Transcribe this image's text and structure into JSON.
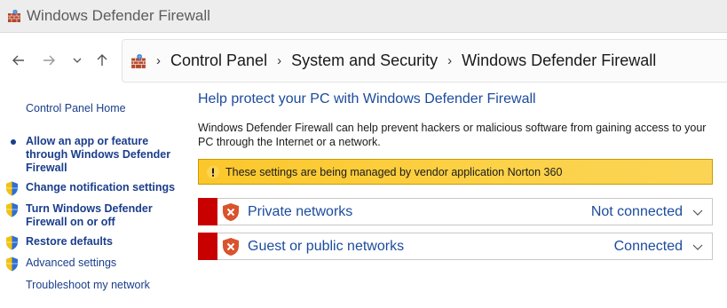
{
  "window": {
    "title": "Windows Defender Firewall",
    "icon": "firewall-icon"
  },
  "nav": {
    "back_icon": "arrow-left-icon",
    "forward_icon": "arrow-right-icon",
    "recent_icon": "chevron-down-icon",
    "up_icon": "arrow-up-icon"
  },
  "address": {
    "icon": "firewall-icon",
    "separator": "›",
    "crumbs": [
      "Control Panel",
      "System and Security",
      "Windows Defender Firewall"
    ]
  },
  "sidebar": {
    "home_link": "Control Panel Home",
    "items": [
      {
        "label": "Allow an app or feature through Windows Defender Firewall",
        "icon": "bullet",
        "bold": true
      },
      {
        "label": "Change notification settings",
        "icon": "uac-shield-icon",
        "bold": true
      },
      {
        "label": "Turn Windows Defender Firewall on or off",
        "icon": "uac-shield-icon",
        "bold": true
      },
      {
        "label": "Restore defaults",
        "icon": "uac-shield-icon",
        "bold": true
      },
      {
        "label": "Advanced settings",
        "icon": "uac-shield-icon",
        "bold": false
      }
    ],
    "troubleshoot_link": "Troubleshoot my network"
  },
  "main": {
    "heading": "Help protect your PC with Windows Defender Firewall",
    "description": "Windows Defender Firewall can help prevent hackers or malicious software from gaining access to your PC through the Internet or a network.",
    "warning": {
      "icon": "warning-icon",
      "text": "These settings are being managed by vendor application Norton 360",
      "color": "#fbc72b"
    },
    "networks": [
      {
        "name": "Private networks",
        "status": "Not connected",
        "icon": "red-x-shield-icon",
        "bar_color": "#c80000"
      },
      {
        "name": "Guest or public networks",
        "status": "Connected",
        "icon": "red-x-shield-icon",
        "bar_color": "#c80000"
      }
    ]
  },
  "colors": {
    "link": "#1a3e8c",
    "heading": "#1b4b9c",
    "accent_red": "#c80000"
  }
}
